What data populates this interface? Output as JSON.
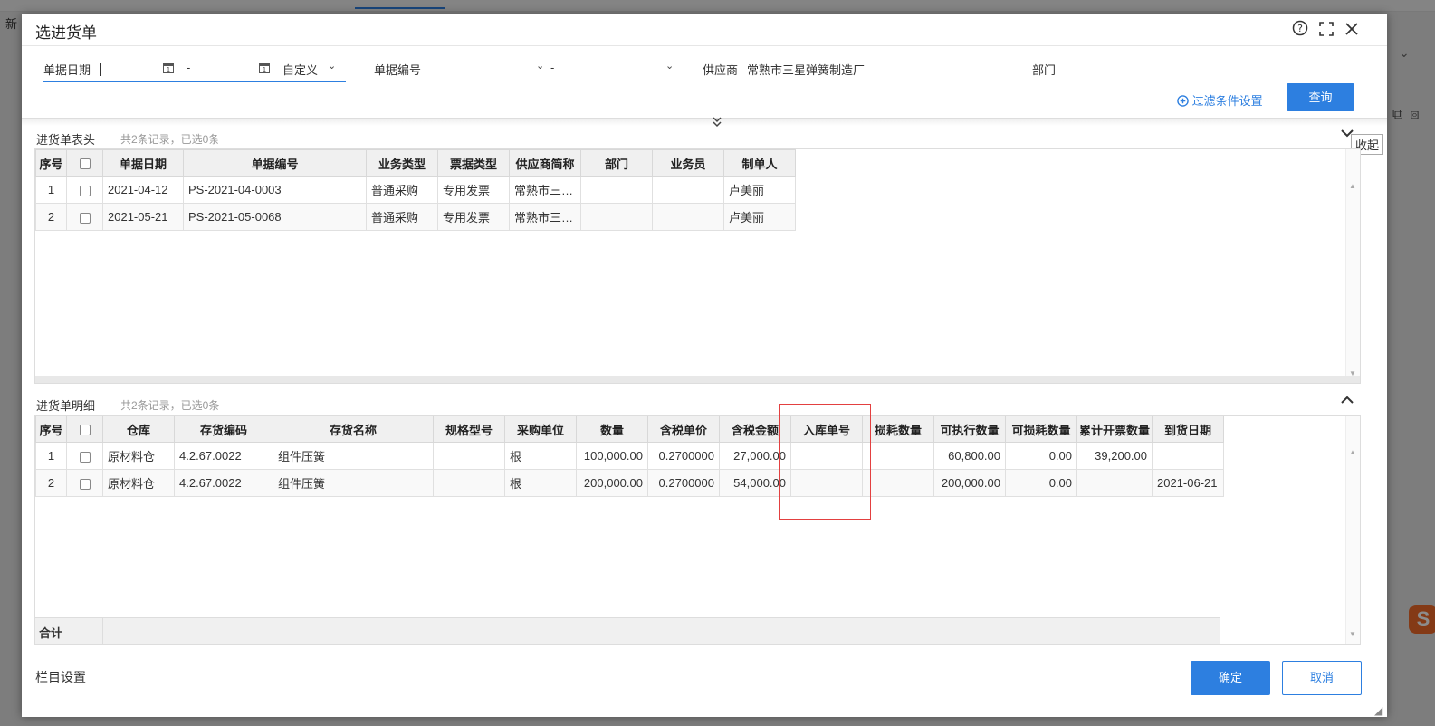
{
  "background": {
    "left_text": "新",
    "logo": "S"
  },
  "dialog": {
    "title": "选进货单",
    "icons": {
      "help": "help-icon",
      "maximize": "maximize-icon",
      "close": "close-icon"
    }
  },
  "filters": {
    "date_label": "单据日期",
    "date_sep": "-",
    "date_mode": "自定义",
    "docno_label": "单据编号",
    "docno_sep": "-",
    "supplier_label": "供应商",
    "supplier_value": "常熟市三星弹簧制造厂",
    "dept_label": "部门",
    "filter_settings": "过滤条件设置",
    "query_button": "查询"
  },
  "header_section": {
    "title": "进货单表头",
    "summary": "共2条记录，已选0条",
    "collapse_tooltip": "收起",
    "columns": [
      "序号",
      "",
      "单据日期",
      "单据编号",
      "业务类型",
      "票据类型",
      "供应商简称",
      "部门",
      "业务员",
      "制单人"
    ],
    "rows": [
      [
        "1",
        "",
        "2021-04-12",
        "PS-2021-04-0003",
        "普通采购",
        "专用发票",
        "常熟市三…",
        "",
        "",
        "卢美丽"
      ],
      [
        "2",
        "",
        "2021-05-21",
        "PS-2021-05-0068",
        "普通采购",
        "专用发票",
        "常熟市三…",
        "",
        "",
        "卢美丽"
      ]
    ]
  },
  "detail_section": {
    "title": "进货单明细",
    "summary": "共2条记录，已选0条",
    "columns": [
      "序号",
      "",
      "仓库",
      "存货编码",
      "存货名称",
      "规格型号",
      "采购单位",
      "数量",
      "含税单价",
      "含税金额",
      "入库单号",
      "损耗数量",
      "可执行数量",
      "可损耗数量",
      "累计开票数量",
      "到货日期"
    ],
    "rows": [
      [
        "1",
        "",
        "原材料仓",
        "4.2.67.0022",
        "组件压簧",
        "",
        "根",
        "100,000.00",
        "0.2700000",
        "27,000.00",
        "",
        "",
        "60,800.00",
        "0.00",
        "39,200.00",
        ""
      ],
      [
        "2",
        "",
        "原材料仓",
        "4.2.67.0022",
        "组件压簧",
        "",
        "根",
        "200,000.00",
        "0.2700000",
        "54,000.00",
        "",
        "",
        "200,000.00",
        "0.00",
        "",
        "2021-06-21"
      ]
    ],
    "total_label": "合计"
  },
  "footer": {
    "column_settings": "栏目设置",
    "confirm": "确定",
    "cancel": "取消"
  },
  "colors": {
    "accent": "#2d7fe0",
    "highlight": "#e34040"
  }
}
